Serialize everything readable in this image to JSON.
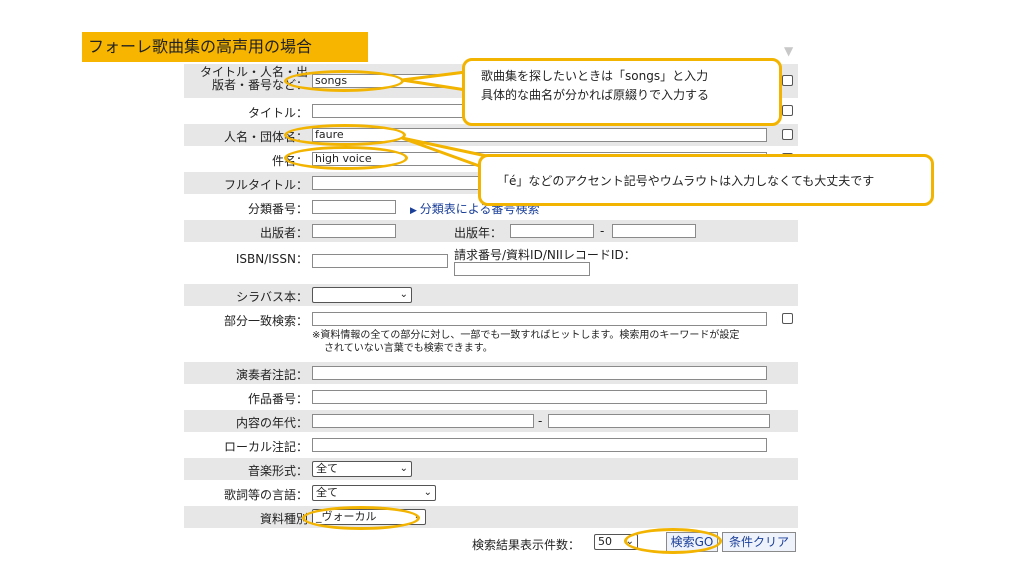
{
  "banner": "フォーレ歌曲集の高声用の場合",
  "form": {
    "free_label_line1": "タイトル・人名・出",
    "free_label_line2": "版者・番号など：",
    "free_value": "songs",
    "title_label": "タイトル：",
    "title_value": "",
    "name_label": "人名・団体名：",
    "name_value": "faure",
    "subject_label": "件名：",
    "subject_value": "high voice",
    "fulltitle_label": "フルタイトル：",
    "fulltitle_value": "",
    "classification_label": "分類番号：",
    "classification_link": "分類表による番号検索",
    "publisher_label": "出版者：",
    "pubyear_label": "出版年：",
    "pubyear_sep": "-",
    "isbn_label": "ISBN/ISSN：",
    "callnumber_label": "請求番号/資料ID/NIIレコードID：",
    "syllabus_label": "シラバス本：",
    "partial_label": "部分一致検索：",
    "partial_note_line1": "※資料情報の全ての部分に対し、一部でも一致すればヒットします。検索用のキーワードが設定",
    "partial_note_line2": "されていない言葉でも検索できます。",
    "performer_label": "演奏者注記：",
    "opus_label": "作品番号：",
    "era_label": "内容の年代：",
    "era_sep": "-",
    "local_label": "ローカル注記：",
    "form_label": "音楽形式：",
    "form_value": "全て",
    "lyrics_lang_label": "歌詞等の言語：",
    "lyrics_lang_value": "全て",
    "material_label": "資料種別",
    "material_value": "_ヴォーカル",
    "results_label": "検索結果表示件数：",
    "results_value": "50",
    "search_button": "検索GO",
    "clear_button": "条件クリア"
  },
  "callouts": {
    "songs_line1": "歌曲集を探したいときは「songs」と入力",
    "songs_line2": "具体的な曲名が分かれば原綴りで入力する",
    "accent": "「é」などのアクセント記号やウムラウトは入力しなくても大丈夫です"
  },
  "colors": {
    "highlight": "#f2b400",
    "banner": "#f7b500",
    "row_gray": "#e7e7e7",
    "link": "#1a3f99"
  },
  "icons": {
    "caret": "chevron-down-icon",
    "link_bullet": "triangle-right-icon",
    "sort": "down-arrow-icon"
  }
}
